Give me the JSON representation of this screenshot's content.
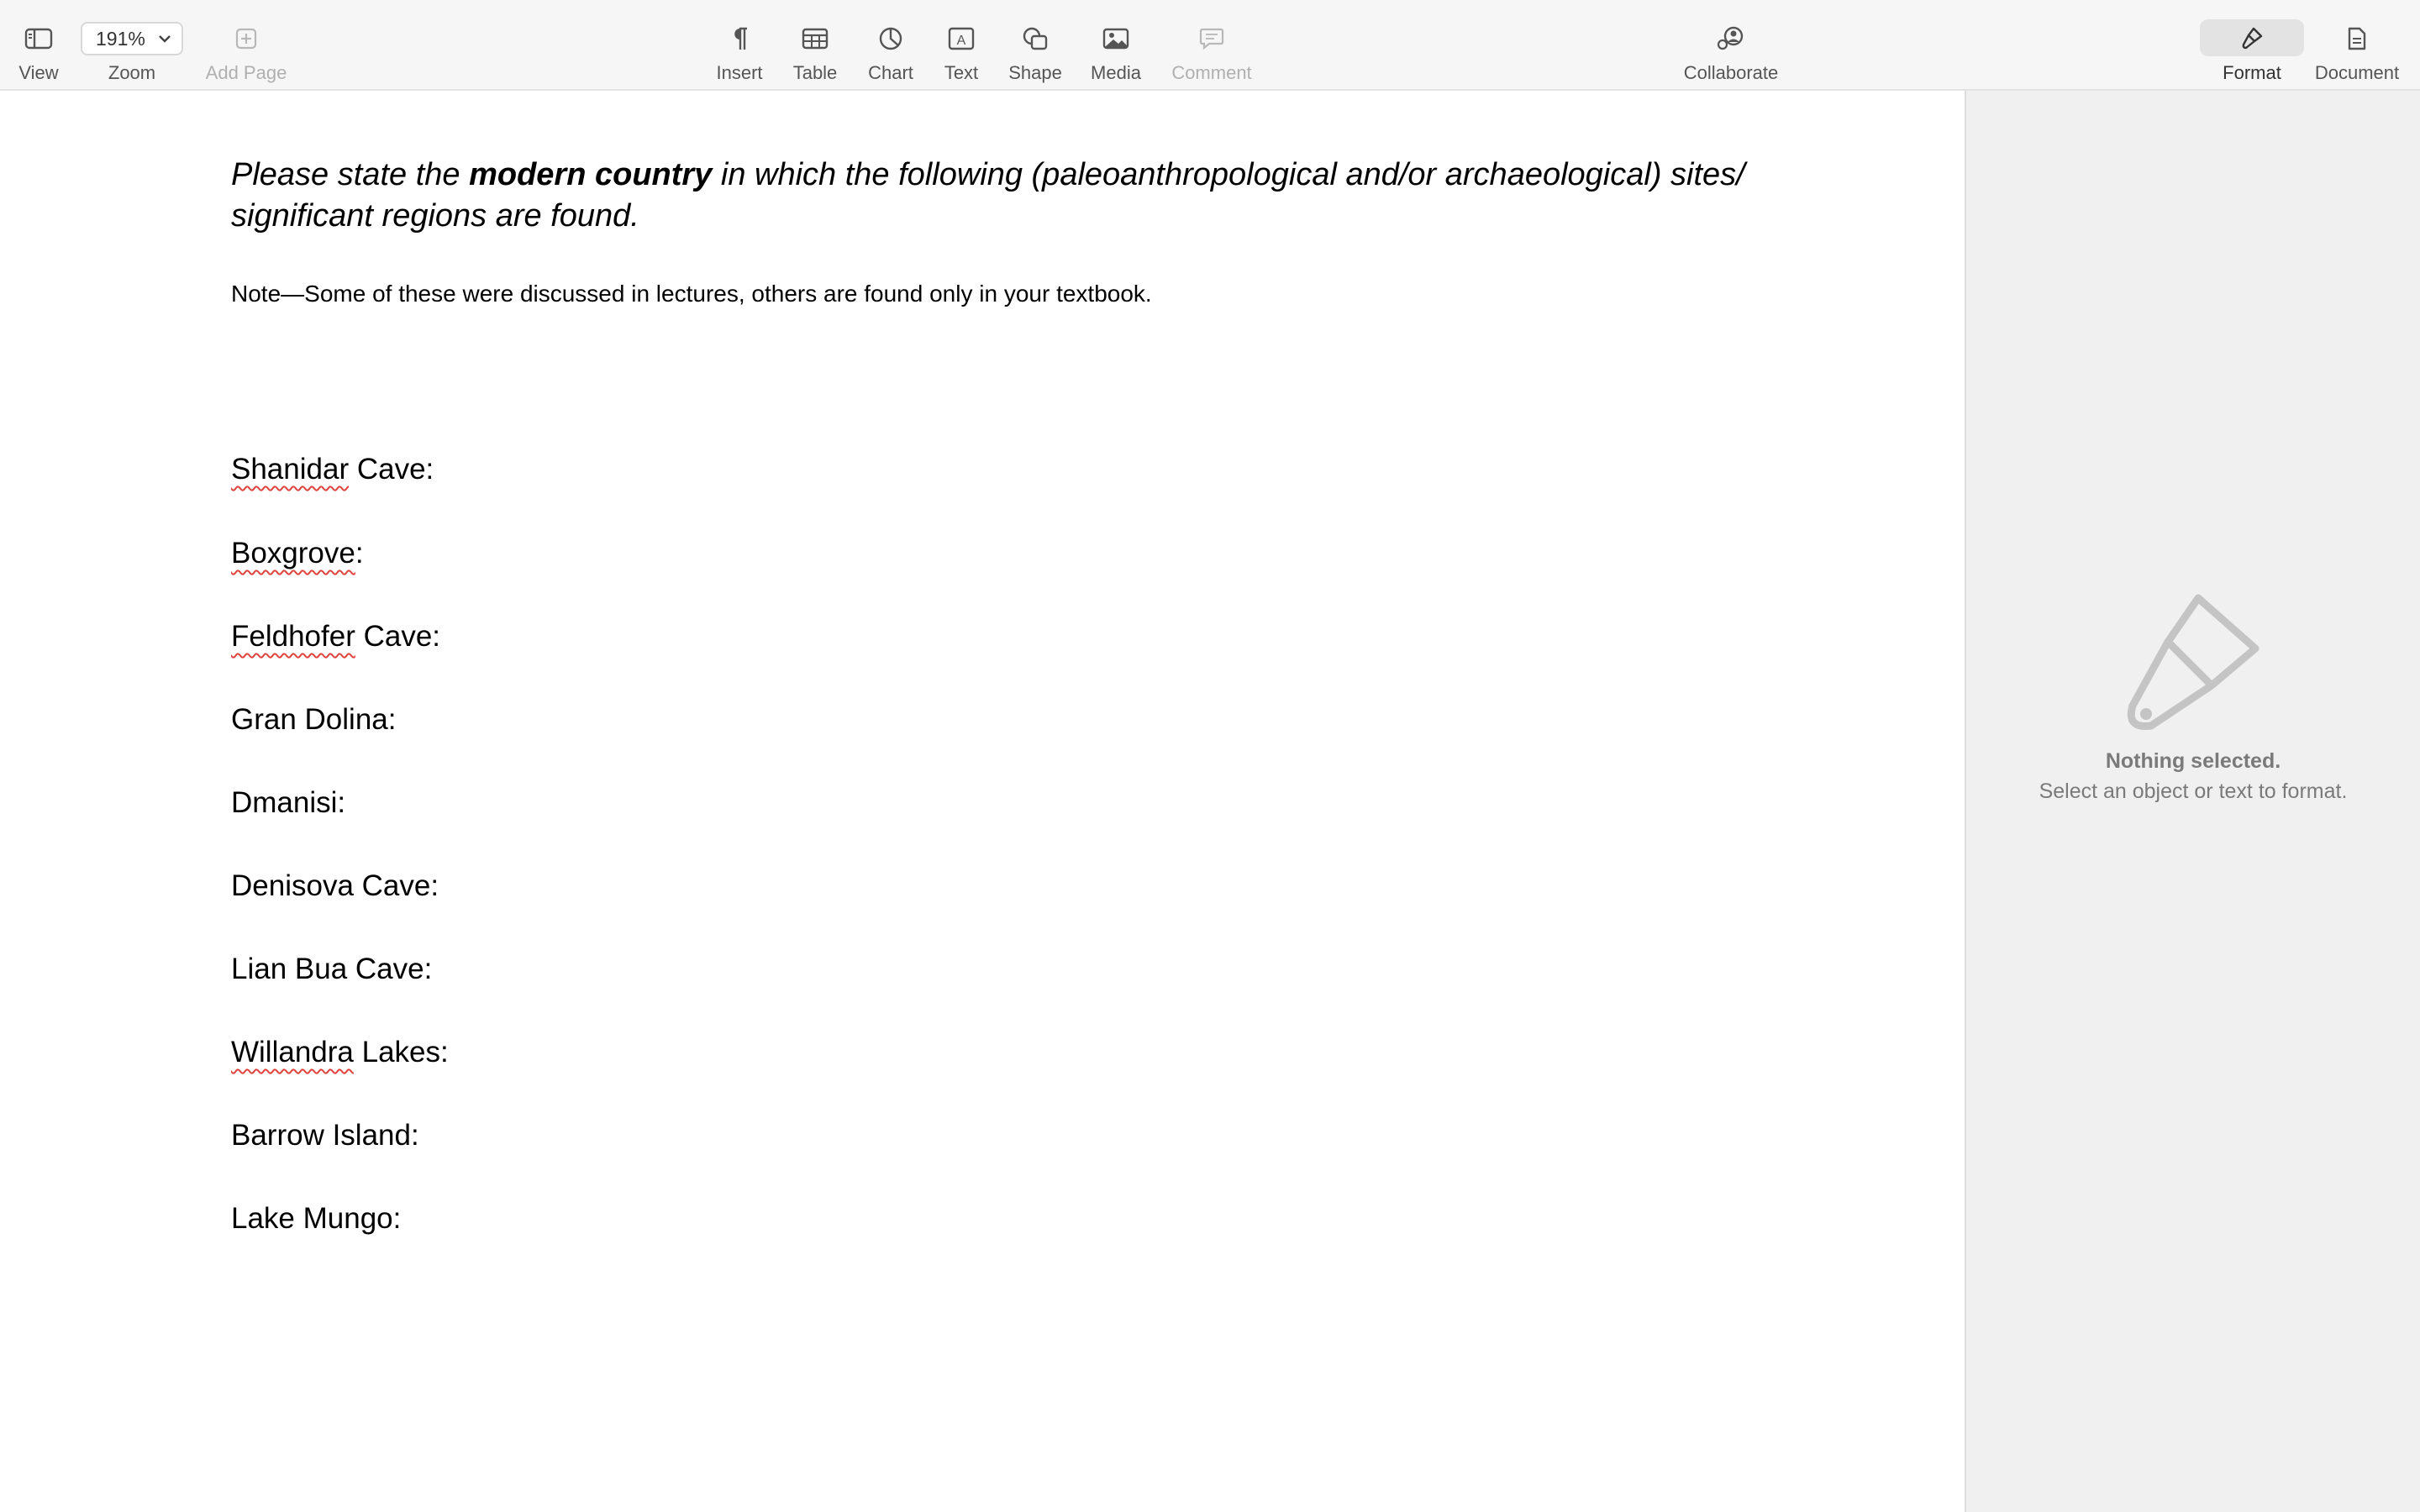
{
  "toolbar": {
    "view": "View",
    "zoom_value": "191%",
    "zoom": "Zoom",
    "add_page": "Add Page",
    "insert": "Insert",
    "table": "Table",
    "chart": "Chart",
    "text": "Text",
    "text_icon_letter": "A",
    "shape": "Shape",
    "media": "Media",
    "comment": "Comment",
    "collaborate": "Collaborate",
    "format": "Format",
    "document": "Document"
  },
  "document": {
    "heading": {
      "part1": "Please state the ",
      "bold": "modern country",
      "part2": " in which the following (paleoanthropological and/or archaeological) sites/",
      "line2": "significant regions are found."
    },
    "note": "Note—Some of these were discussed in lectures, others are found only in your textbook.",
    "sites": [
      {
        "name": "Shanidar",
        "rest": " Cave:"
      },
      {
        "name": "Boxgrove",
        "rest": ":"
      },
      {
        "name": "Feldhofer",
        "rest": " Cave:"
      },
      {
        "name": "Gran Dolina:",
        "rest": ""
      },
      {
        "name": "Dmanisi:",
        "rest": ""
      },
      {
        "name": "Denisova Cave:",
        "rest": ""
      },
      {
        "name": "Lian Bua Cave:",
        "rest": ""
      },
      {
        "name": "Willandra",
        "rest": " Lakes:"
      },
      {
        "name": "Barrow Island:",
        "rest": ""
      },
      {
        "name": "Lake Mungo:",
        "rest": ""
      }
    ]
  },
  "sidebar": {
    "empty_title": "Nothing selected.",
    "empty_subtitle": "Select an object or text to format."
  }
}
